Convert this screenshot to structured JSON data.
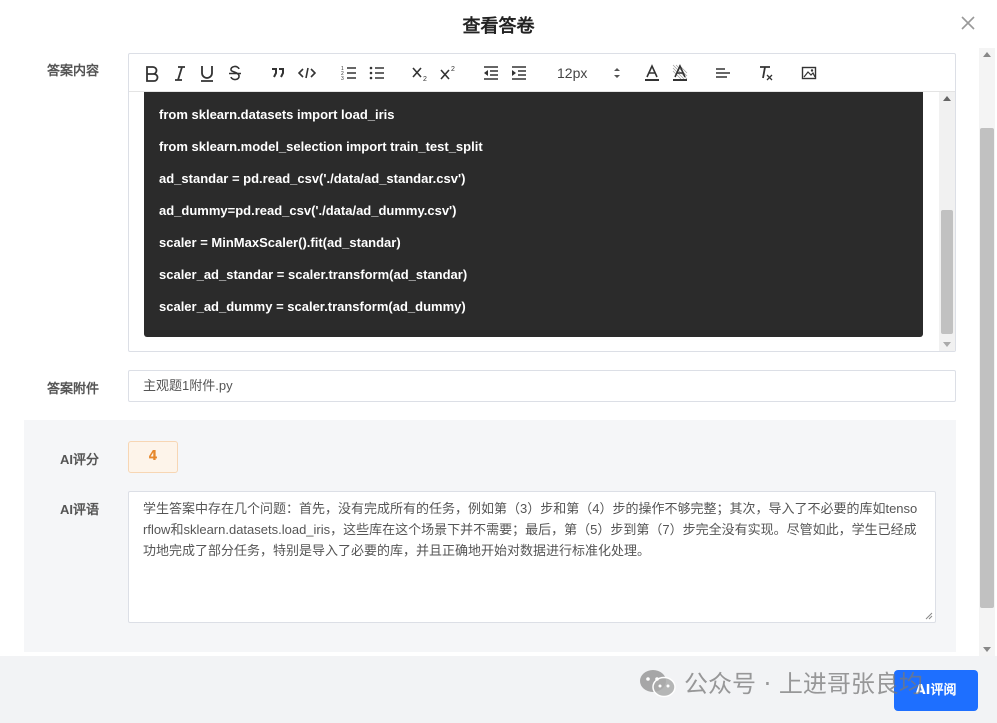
{
  "dialog": {
    "title": "查看答卷"
  },
  "answer": {
    "label": "答案内容",
    "toolbar": {
      "font_size": "12px"
    },
    "code_lines": [
      "from sklearn.datasets import load_iris",
      "from sklearn.model_selection import train_test_split",
      "ad_standar = pd.read_csv('./data/ad_standar.csv')",
      "ad_dummy=pd.read_csv('./data/ad_dummy.csv')",
      "scaler = MinMaxScaler().fit(ad_standar)",
      "scaler_ad_standar = scaler.transform(ad_standar)",
      "scaler_ad_dummy = scaler.transform(ad_dummy)"
    ]
  },
  "attachment": {
    "label": "答案附件",
    "value": "主观题1附件.py"
  },
  "ai": {
    "score_label": "AI评分",
    "score": "4",
    "comment_label": "AI评语",
    "comment": "学生答案中存在几个问题：首先，没有完成所有的任务，例如第（3）步和第（4）步的操作不够完整；其次，导入了不必要的库如tensorflow和sklearn.datasets.load_iris，这些库在这个场景下并不需要；最后，第（5）步到第（7）步完全没有实现。尽管如此，学生已经成功地完成了部分任务，特别是导入了必要的库，并且正确地开始对数据进行标准化处理。"
  },
  "footer": {
    "review_button": "AI评阅"
  },
  "watermark": {
    "text": "公众号 · 上进哥张良均"
  },
  "colors": {
    "primary": "#1e6fff",
    "code_bg": "#2b2b2b",
    "score_text": "#e6882d"
  }
}
